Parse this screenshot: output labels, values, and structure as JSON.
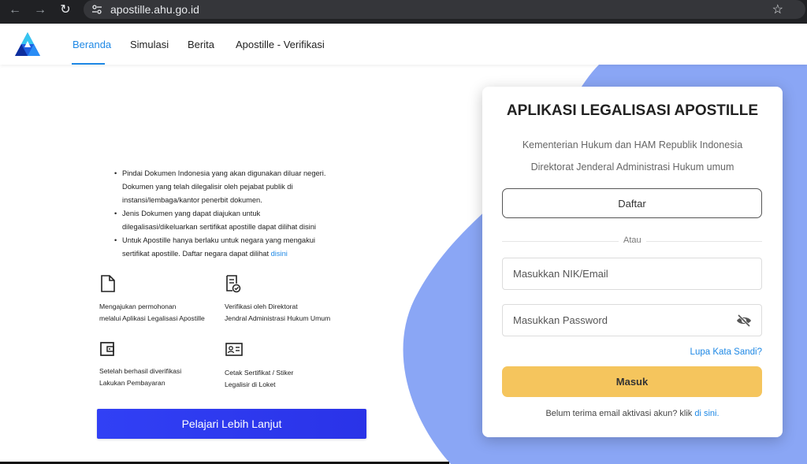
{
  "browser": {
    "url": "apostille.ahu.go.id"
  },
  "nav": {
    "items": [
      {
        "label": "Beranda"
      },
      {
        "label": "Simulasi"
      },
      {
        "label": "Berita"
      },
      {
        "label": "Apostille - Verifikasi"
      }
    ],
    "active": "Beranda"
  },
  "info": {
    "bullets": [
      "Pindai Dokumen Indonesia yang akan digunakan diluar negeri. Dokumen yang telah dilegalisir oleh pejabat publik di instansi/lembaga/kantor penerbit dokumen.",
      "Jenis Dokumen yang dapat diajukan untuk dilegalisasi/dikeluarkan sertifikat apostille dapat dilihat disini",
      "Untuk Apostille hanya berlaku untuk negara yang mengakui sertifikat apostille. Daftar negara dapat dilihat"
    ],
    "bullet3_link": "disini"
  },
  "features": [
    {
      "line1": "Mengajukan permohonan",
      "line2": "melalui Aplikasi Legalisasi Apostille",
      "icon": "document-icon"
    },
    {
      "line1": "Verifikasi oleh Direktorat",
      "line2": "Jendral Administrasi Hukum Umum",
      "icon": "verified-document-icon"
    },
    {
      "line1": "Setelah berhasil diverifikasi",
      "line2": "Lakukan Pembayaran",
      "icon": "wallet-icon"
    },
    {
      "line1": "Cetak Sertifikat / Stiker",
      "line2": "Legalisir di Loket",
      "icon": "certificate-card-icon"
    }
  ],
  "learn_more_label": "Pelajari Lebih Lanjut",
  "login": {
    "title": "APLIKASI LEGALISASI APOSTILLE",
    "subtitle1": "Kementerian Hukum dan HAM Republik Indonesia",
    "subtitle2": "Direktorat Jenderal Administrasi Hukum umum",
    "register_label": "Daftar",
    "or_label": "Atau",
    "nik_placeholder": "Masukkan NIK/Email",
    "password_placeholder": "Masukkan Password",
    "forgot_label": "Lupa Kata Sandi?",
    "login_label": "Masuk",
    "activation_text": "Belum terima email aktivasi akun? klik",
    "activation_link": "di sini."
  },
  "colors": {
    "accent_blue": "#1e88e5",
    "shape_blue": "#8aa6f5",
    "login_button": "#f5c55d",
    "learn_button": "#2f3cf2"
  }
}
